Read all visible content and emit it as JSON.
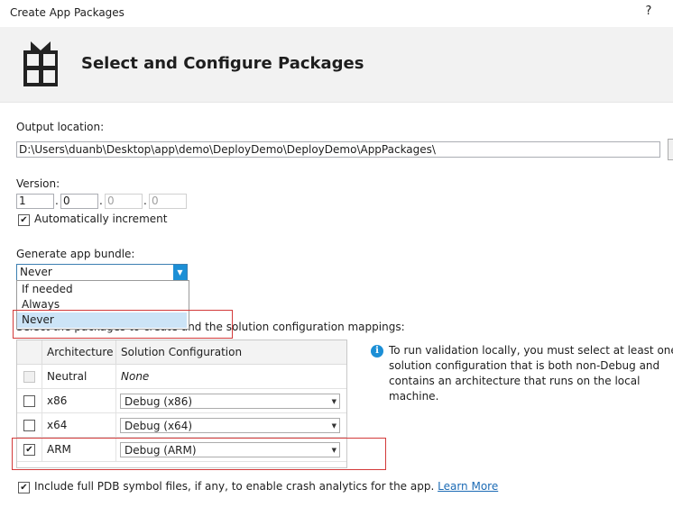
{
  "window": {
    "title": "Create App Packages",
    "help": "?"
  },
  "header": {
    "title": "Select and Configure Packages",
    "icon": "gift-package-icon"
  },
  "output": {
    "label": "Output location:",
    "path": "D:\\Users\\duanb\\Desktop\\app\\demo\\DeployDemo\\DeployDemo\\AppPackages\\"
  },
  "version": {
    "label": "Version:",
    "parts": [
      "1",
      "0",
      "0",
      "0"
    ],
    "auto_increment_label": "Automatically increment",
    "auto_increment_checked": true
  },
  "bundle": {
    "label": "Generate app bundle:",
    "selected": "Never",
    "options": [
      "If needed",
      "Always",
      "Never"
    ]
  },
  "mapping": {
    "instruction": "Select the packages to create and the solution configuration mappings:",
    "columns": [
      "Architecture",
      "Solution Configuration"
    ],
    "rows": [
      {
        "arch": "Neutral",
        "config": "None",
        "checked": false,
        "disabled": true
      },
      {
        "arch": "x86",
        "config": "Debug (x86)",
        "checked": false,
        "disabled": false
      },
      {
        "arch": "x64",
        "config": "Debug (x64)",
        "checked": false,
        "disabled": false
      },
      {
        "arch": "ARM",
        "config": "Debug (ARM)",
        "checked": true,
        "disabled": false
      }
    ]
  },
  "info": {
    "text": "To run validation locally, you must select at least one solution configuration that is both non-Debug and contains an architecture that runs on the local machine."
  },
  "pdb": {
    "label": "Include full PDB symbol files, if any, to enable crash analytics for the app.",
    "checked": true,
    "link": "Learn More"
  },
  "colors": {
    "accent": "#1c8fd6",
    "highlight_box": "#d33a3a",
    "link": "#1c6bb5"
  }
}
